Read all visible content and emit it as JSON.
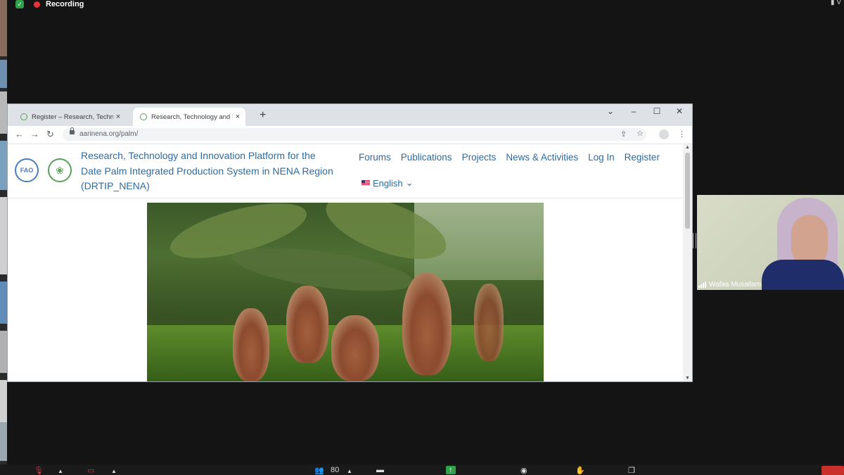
{
  "zoom": {
    "recording_label": "Recording",
    "view_label": "V",
    "participant": {
      "name": "Wafaa Musallam"
    },
    "toolbar": {
      "participant_count": "80"
    }
  },
  "browser": {
    "tabs": [
      {
        "title": "Register – Research, Technology",
        "close": "×"
      },
      {
        "title": "Research, Technology and Innovat",
        "close": "×"
      }
    ],
    "new_tab": "+",
    "window_controls": {
      "minimize": "–",
      "maximize": "☐",
      "close": "✕",
      "tabsearch": "⌄"
    },
    "url": "aarinena.org/palm/",
    "nav": {
      "back": "←",
      "forward": "→",
      "reload": "↻"
    },
    "toolbar_icons": {
      "share": "⇪",
      "bookmark": "☆",
      "menu": "⋮"
    }
  },
  "site": {
    "title_lines": [
      "Research, Technology and Innovation Platform for the",
      "Date Palm Integrated Production System in NENA Region",
      "(DRTIP_NENA)"
    ],
    "logos": {
      "fao": "FAO",
      "aarinena": "❀"
    },
    "nav": [
      "Forums",
      "Publications",
      "Projects",
      "News & Activities",
      "Log In",
      "Register"
    ],
    "language": "English",
    "language_caret": "⌄"
  },
  "colors": {
    "link": "#2b6ca3",
    "record": "#e8333a",
    "zoom_bg": "#141414"
  },
  "icons": {
    "shield": "shield-icon",
    "mic": "microphone-muted-icon",
    "video": "video-muted-icon",
    "participants": "participants-icon",
    "chat": "chat-icon",
    "share": "share-screen-icon",
    "record": "record-icon",
    "reactions": "raise-hand-icon",
    "apps": "apps-icon"
  }
}
